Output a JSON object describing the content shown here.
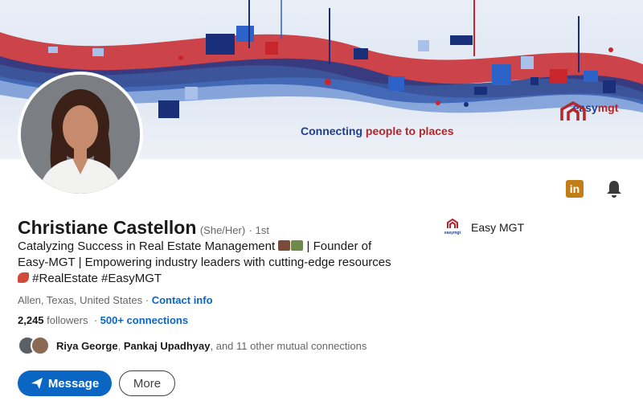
{
  "banner": {
    "tagline_part1": "Connecting ",
    "tagline_part2": "people to places",
    "brand_part1": "easy",
    "brand_part2": "mgt"
  },
  "profile": {
    "name": "Christiane Castellon",
    "pronouns": "(She/Her)",
    "degree": "· 1st",
    "headline_1": "Catalyzing Success in Real Estate Management",
    "headline_2": "| Founder of Easy-MGT | Empowering industry leaders with cutting-edge resources",
    "headline_3": "#RealEstate #EasyMGT",
    "location": "Allen, Texas, United States",
    "location_sep": " · ",
    "contact_info": "Contact info",
    "followers_count": "2,245",
    "followers_label": " followers",
    "connections_sep": "  · ",
    "connections": "500+ connections",
    "mutual_name_1": "Riya George",
    "mutual_sep": ", ",
    "mutual_name_2": "Pankaj Upadhyay",
    "mutual_rest": ", and 11 other mutual connections"
  },
  "actions": {
    "message_label": "Message",
    "more_label": "More"
  },
  "company": {
    "name": "Easy MGT",
    "logo_text": "easymgt"
  },
  "icons": {
    "linkedin_badge": "in",
    "bell": "bell-icon",
    "send": "send-icon"
  },
  "colors": {
    "accent_blue": "#0a66c2",
    "brand_blue": "#1f3e8c",
    "brand_red": "#b3262b",
    "badge_orange": "#c37d16"
  }
}
